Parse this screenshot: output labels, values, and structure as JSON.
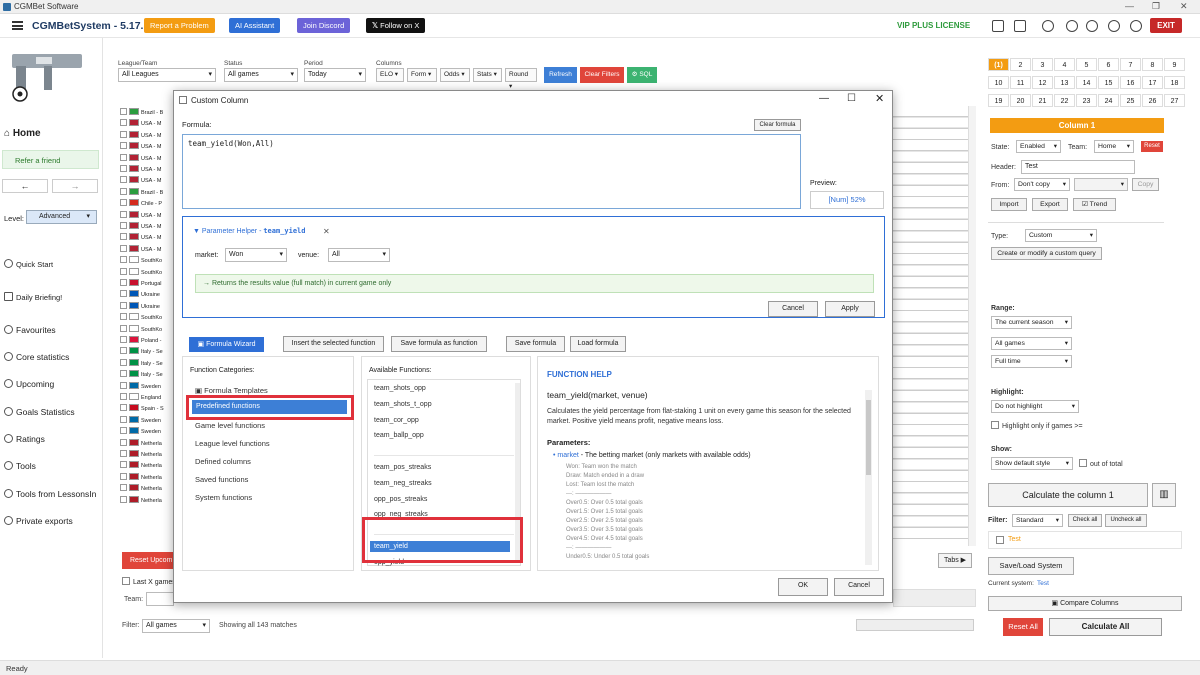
{
  "window": {
    "title": "CGMBet Software",
    "min": "—",
    "max": "❐",
    "close": "✕"
  },
  "appbar": {
    "name": "CGMBetSystem - 5.17.1",
    "buttons": [
      {
        "label": "Report a Problem",
        "color": "#f39c12"
      },
      {
        "label": "AI Assistant",
        "color": "#2f6fd6"
      },
      {
        "label": "Join Discord",
        "color": "#6c63d8"
      },
      {
        "label": "Follow on X",
        "color": "#111111"
      }
    ],
    "license": "VIP PLUS LICENSE",
    "exit": "EXIT",
    "icons": [
      "calculator-icon",
      "edit-icon",
      "export-icon",
      "settings-icon",
      "refresh-icon",
      "history-icon",
      "help-icon",
      "chat-icon",
      "account-icon"
    ]
  },
  "sidebar": {
    "home": "Home",
    "refer": "Refer a friend",
    "back": "←",
    "forward": "→",
    "level_label": "Level:",
    "level_value": "Advanced",
    "items": [
      "Quick Start",
      "Daily Briefing!"
    ],
    "sections": [
      "Favourites",
      "Core statistics",
      "Upcoming",
      "Goals Statistics",
      "Ratings",
      "Tools",
      "Tools from LessonsIn",
      "Private exports"
    ]
  },
  "filters": {
    "league_label": "League/Team",
    "league_value": "All Leagues",
    "status_label": "Status",
    "status_value": "All games",
    "period_label": "Period",
    "period_value": "Today",
    "columns_label": "Columns",
    "column_buttons": [
      "ELO ▾",
      "Form ▾",
      "Odds ▾",
      "Stats ▾",
      "Round ▾"
    ],
    "refresh": "Refresh",
    "clear": "Clear Filters",
    "sql": "SQL"
  },
  "grid_rows": [
    {
      "name": "Brazil - B",
      "flag": "br"
    },
    {
      "name": "USA - M",
      "flag": "us"
    },
    {
      "name": "USA - M",
      "flag": "us"
    },
    {
      "name": "USA - M",
      "flag": "us"
    },
    {
      "name": "USA - M",
      "flag": "us"
    },
    {
      "name": "USA - M",
      "flag": "us"
    },
    {
      "name": "USA - M",
      "flag": "us"
    },
    {
      "name": "Brazil - B",
      "flag": "br"
    },
    {
      "name": "Chile - P",
      "flag": "cl"
    },
    {
      "name": "USA - M",
      "flag": "us"
    },
    {
      "name": "USA - M",
      "flag": "us"
    },
    {
      "name": "USA - M",
      "flag": "us"
    },
    {
      "name": "USA - M",
      "flag": "us"
    },
    {
      "name": "SouthKo",
      "flag": "kr"
    },
    {
      "name": "SouthKo",
      "flag": "kr"
    },
    {
      "name": "Portugal",
      "flag": "pt"
    },
    {
      "name": "Ukraine",
      "flag": "ua"
    },
    {
      "name": "Ukraine",
      "flag": "ua"
    },
    {
      "name": "SouthKo",
      "flag": "kr"
    },
    {
      "name": "SouthKo",
      "flag": "kr"
    },
    {
      "name": "Poland -",
      "flag": "pl"
    },
    {
      "name": "Italy - Se",
      "flag": "it"
    },
    {
      "name": "Italy - Se",
      "flag": "it"
    },
    {
      "name": "Italy - Se",
      "flag": "it"
    },
    {
      "name": "Sweden",
      "flag": "se"
    },
    {
      "name": "England",
      "flag": "en"
    },
    {
      "name": "Spain - S",
      "flag": "es"
    },
    {
      "name": "Sweden",
      "flag": "se"
    },
    {
      "name": "Sweden",
      "flag": "se"
    },
    {
      "name": "Netherla",
      "flag": "nl"
    },
    {
      "name": "Netherla",
      "flag": "nl"
    },
    {
      "name": "Netherla",
      "flag": "nl"
    },
    {
      "name": "Netherla",
      "flag": "nl"
    },
    {
      "name": "Netherla",
      "flag": "nl"
    },
    {
      "name": "Netherla",
      "flag": "nl"
    }
  ],
  "bottom": {
    "reset_upcoming": "Reset Upcom",
    "last_x": "Last X games",
    "team_label": "Team:",
    "filter_label": "Filter:",
    "filter_value": "All games",
    "showing": "Showing all 143 matches",
    "tabs": "Tabs ▶"
  },
  "right_panel": {
    "numbers": [
      "(1)",
      "2",
      "3",
      "4",
      "5",
      "6",
      "7",
      "8",
      "9",
      "10",
      "11",
      "12",
      "13",
      "14",
      "15",
      "16",
      "17",
      "18",
      "19",
      "20",
      "21",
      "22",
      "23",
      "24",
      "25",
      "26",
      "27"
    ],
    "column_title": "Column 1",
    "state_label": "State:",
    "state_value": "Enabled",
    "team_label": "Team:",
    "team_value": "Home",
    "reset": "Reset",
    "header_label": "Header:",
    "header_value": "Test",
    "from_label": "From:",
    "from_value": "Don't copy",
    "copy": "Copy",
    "import": "Import",
    "export": "Export",
    "trend": "Trend",
    "type_label": "Type:",
    "type_value": "Custom",
    "custom_query": "Create or modify a custom query",
    "range_label": "Range:",
    "range_value": "The current season",
    "games_value": "All games",
    "time_value": "Full time",
    "highlight_label": "Highlight:",
    "highlight_value": "Do not highlight",
    "highlight_only": "Highlight only if games >=",
    "show_label": "Show:",
    "show_value": "Show default style",
    "out_of_total": "out of total",
    "calculate": "Calculate the column 1",
    "filter_label": "Filter:",
    "filter_value": "Standard",
    "check_all": "Check all",
    "uncheck_all": "Uncheck all",
    "filter_item": "Test",
    "save_load": "Save/Load System",
    "current_system_label": "Current system:",
    "current_system": "Test",
    "compare": "Compare Columns",
    "reset_all": "Reset All",
    "calculate_all": "Calculate All"
  },
  "dialog": {
    "title": "Custom Column",
    "formula_label": "Formula:",
    "clear_formula": "Clear formula",
    "formula": "team_yield(Won,All)",
    "preview_label": "Preview:",
    "preview_value": "[Num] 52%",
    "param_helper": "▼ Parameter Helper - ",
    "param_func": "team_yield",
    "param_close": "✕",
    "market_label": "market:",
    "market_value": "Won",
    "venue_label": "venue:",
    "venue_value": "All",
    "returns_text": "→ Returns the results value (full match) in current game only",
    "cancel": "Cancel",
    "apply": "Apply",
    "wizard": "Formula Wizard",
    "insert_fn": "Insert the selected function",
    "save_as_fn": "Save formula as function",
    "save_formula": "Save formula",
    "load_formula": "Load formula",
    "categories_title": "Function Categories:",
    "categories": [
      "Formula Templates",
      "Predefined functions",
      "Game level functions",
      "League level functions",
      "Defined columns",
      "Saved functions",
      "System functions"
    ],
    "functions_title": "Available Functions:",
    "functions": [
      "team_shots_opp",
      "team_shots_t_opp",
      "team_cor_opp",
      "team_ballp_opp",
      "",
      "team_pos_streaks",
      "team_neg_streaks",
      "opp_pos_streaks",
      "opp_neg_streaks",
      "",
      "team_yield",
      "opp_yield"
    ],
    "help_title": "FUNCTION HELP",
    "help_sig": "team_yield(market, venue)",
    "help_desc": "Calculates the yield percentage from flat-staking 1 unit on every game this season for the selected market. Positive yield means profit, negative means loss.",
    "params_title": "Parameters:",
    "param_market": "• market",
    "param_market_desc": " - The betting market (only markets with available odds)",
    "help_lines": [
      "Won: Team won the match",
      "Draw: Match ended in a draw",
      "Lost: Team lost the match",
      "---: ——————",
      "Over0.5: Over 0.5 total goals",
      "Over1.5: Over 1.5 total goals",
      "Over2.5: Over 2.5 total goals",
      "Over3.5: Over 3.5 total goals",
      "Over4.5: Over 4.5 total goals",
      "---: ——————",
      "Under0.5: Under 0.5 total goals"
    ],
    "ok": "OK",
    "cancel_bottom": "Cancel"
  },
  "status": "Ready"
}
